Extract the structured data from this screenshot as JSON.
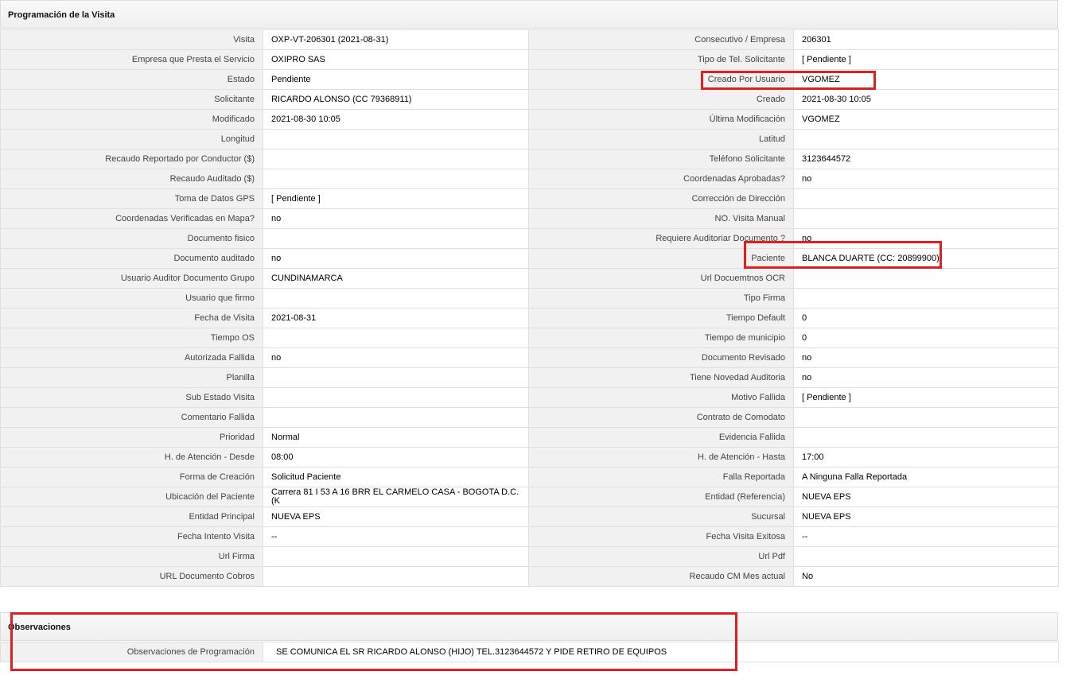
{
  "section_programacion": {
    "title": "Programación de la Visita"
  },
  "rows": [
    [
      {
        "l": "Visita",
        "v": "OXP-VT-206301 (2021-08-31)"
      },
      {
        "l": "Consecutivo / Empresa",
        "v": "206301"
      }
    ],
    [
      {
        "l": "Empresa que Presta el Servicio",
        "v": "OXIPRO SAS"
      },
      {
        "l": "Tipo de Tel. Solicitante",
        "v": "[ Pendiente ]"
      }
    ],
    [
      {
        "l": "Estado",
        "v": "Pendiente"
      },
      {
        "l": "Creado Por Usuario",
        "v": "VGOMEZ"
      }
    ],
    [
      {
        "l": "Solicitante",
        "v": "RICARDO ALONSO (CC 79368911)"
      },
      {
        "l": "Creado",
        "v": "2021-08-30 10:05"
      }
    ],
    [
      {
        "l": "Modificado",
        "v": "2021-08-30 10:05"
      },
      {
        "l": "Última Modificación",
        "v": " VGOMEZ"
      }
    ],
    [
      {
        "l": "Longitud",
        "v": ""
      },
      {
        "l": "Latitud",
        "v": ""
      }
    ],
    [
      {
        "l": "Recaudo Reportado por Conductor ($)",
        "v": ""
      },
      {
        "l": "Teléfono Solicitante",
        "v": "3123644572"
      }
    ],
    [
      {
        "l": "Recaudo Auditado ($)",
        "v": ""
      },
      {
        "l": "Coordenadas Aprobadas?",
        "v": " no"
      }
    ],
    [
      {
        "l": "Toma de Datos GPS",
        "v": "[ Pendiente ]"
      },
      {
        "l": "Corrección de Dirección",
        "v": ""
      }
    ],
    [
      {
        "l": "Coordenadas Verificadas en Mapa?",
        "v": " no"
      },
      {
        "l": "NO. Visita Manual",
        "v": ""
      }
    ],
    [
      {
        "l": "Documento fisico",
        "v": ""
      },
      {
        "l": "Requiere Auditoriar Documento ?",
        "v": " no"
      }
    ],
    [
      {
        "l": "Documento auditado",
        "v": " no"
      },
      {
        "l": "Paciente",
        "v": "BLANCA DUARTE (CC: 20899900)"
      }
    ],
    [
      {
        "l": "Usuario Auditor Documento Grupo",
        "v": "CUNDINAMARCA"
      },
      {
        "l": "Url Docuemtnos OCR",
        "v": ""
      }
    ],
    [
      {
        "l": "Usuario que firmo",
        "v": ""
      },
      {
        "l": "Tipo Firma",
        "v": ""
      }
    ],
    [
      {
        "l": "Fecha de Visita",
        "v": " 2021-08-31"
      },
      {
        "l": "Tiempo Default",
        "v": "0"
      }
    ],
    [
      {
        "l": "Tiempo OS",
        "v": ""
      },
      {
        "l": "Tiempo de municipio",
        "v": "0"
      }
    ],
    [
      {
        "l": "Autorizada Fallida",
        "v": " no"
      },
      {
        "l": "Documento Revisado",
        "v": " no"
      }
    ],
    [
      {
        "l": "Planilla",
        "v": ""
      },
      {
        "l": "Tiene Novedad Auditoria",
        "v": " no"
      }
    ],
    [
      {
        "l": "Sub Estado Visita",
        "v": ""
      },
      {
        "l": "Motivo Fallida",
        "v": "[ Pendiente ]"
      }
    ],
    [
      {
        "l": "Comentario Fallida",
        "v": ""
      },
      {
        "l": "Contrato de Comodato",
        "v": ""
      }
    ],
    [
      {
        "l": "Prioridad",
        "v": "Normal"
      },
      {
        "l": "Evidencia Fallida",
        "v": ""
      }
    ],
    [
      {
        "l": "H. de Atención - Desde",
        "v": "08:00"
      },
      {
        "l": "H. de Atención - Hasta",
        "v": " 17:00"
      }
    ],
    [
      {
        "l": "Forma de Creación",
        "v": "Solicitud Paciente"
      },
      {
        "l": "Falla Reportada",
        "v": "A Ninguna Falla Reportada"
      }
    ],
    [
      {
        "l": "Ubicación del Paciente",
        "v": "Carrera 81 I 53 A 16 BRR EL CARMELO CASA - BOGOTA D.C. (K"
      },
      {
        "l": "Entidad (Referencia)",
        "v": "NUEVA EPS"
      }
    ],
    [
      {
        "l": "Entidad Principal",
        "v": "NUEVA EPS"
      },
      {
        "l": "Sucursal",
        "v": "NUEVA EPS"
      }
    ],
    [
      {
        "l": "Fecha Intento Visita",
        "v": " --"
      },
      {
        "l": "Fecha Visita Exitosa",
        "v": " --"
      }
    ],
    [
      {
        "l": "Url Firma",
        "v": ""
      },
      {
        "l": "Url Pdf",
        "v": ""
      }
    ],
    [
      {
        "l": "URL Documento Cobros",
        "v": ""
      },
      {
        "l": "Recaudo CM Mes actual",
        "v": "No"
      }
    ]
  ],
  "section_observaciones": {
    "title": "Observaciones",
    "label": "Observaciones de Programación",
    "value": "SE COMUNICA EL SR RICARDO ALONSO (HIJO) TEL.3123644572 Y PIDE RETIRO DE EQUIPOS"
  },
  "colors": {
    "highlight": "#e02020",
    "label_bg": "#f1f1f1",
    "border": "#dfdfdf"
  }
}
